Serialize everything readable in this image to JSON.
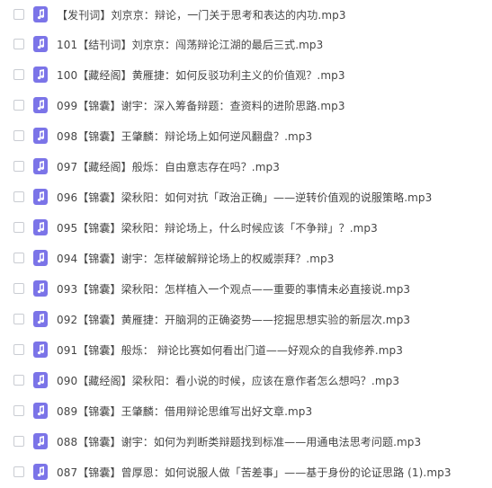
{
  "files": [
    {
      "name": "【发刊词】刘京京：辩论，一门关于思考和表达的内功.mp3"
    },
    {
      "name": "101【结刊词】刘京京：闯荡辩论江湖的最后三式.mp3"
    },
    {
      "name": "100【藏经阁】黄雁捷：如何反驳功利主义的价值观？.mp3"
    },
    {
      "name": "099【锦囊】谢宇：深入筹备辩题：查资料的进阶思路.mp3"
    },
    {
      "name": "098【锦囊】王肇麟：辩论场上如何逆风翻盘？.mp3"
    },
    {
      "name": "097【藏经阁】般烁：自由意志存在吗？.mp3"
    },
    {
      "name": "096【锦囊】梁秋阳：如何对抗「政治正确」——逆转价值观的说服策略.mp3"
    },
    {
      "name": "095【锦囊】梁秋阳：辩论场上，什么时候应该「不争辩」？.mp3"
    },
    {
      "name": "094【锦囊】谢宇：怎样破解辩论场上的权威崇拜？.mp3"
    },
    {
      "name": "093【锦囊】梁秋阳：怎样植入一个观点——重要的事情未必直接说.mp3"
    },
    {
      "name": "092【锦囊】黄雁捷：开脑洞的正确姿势——挖掘思想实验的新层次.mp3"
    },
    {
      "name": "091【锦囊】般烁： 辩论比赛如何看出门道——好观众的自我修养.mp3"
    },
    {
      "name": "090【藏经阁】梁秋阳：看小说的时候，应该在意作者怎么想吗？.mp3"
    },
    {
      "name": "089【锦囊】王肇麟：借用辩论思维写出好文章.mp3"
    },
    {
      "name": "088【锦囊】谢宇：如何为判断类辩题找到标准——用通电法思考问题.mp3"
    },
    {
      "name": "087【锦囊】曾厚恩：如何说服人做「苦差事」——基于身份的论证思路 (1).mp3"
    }
  ],
  "colors": {
    "icon_bg": "#7b74e8",
    "text": "#454545",
    "checkbox_border": "#c9ccd2"
  },
  "icons": {
    "file": "music-note-icon"
  }
}
